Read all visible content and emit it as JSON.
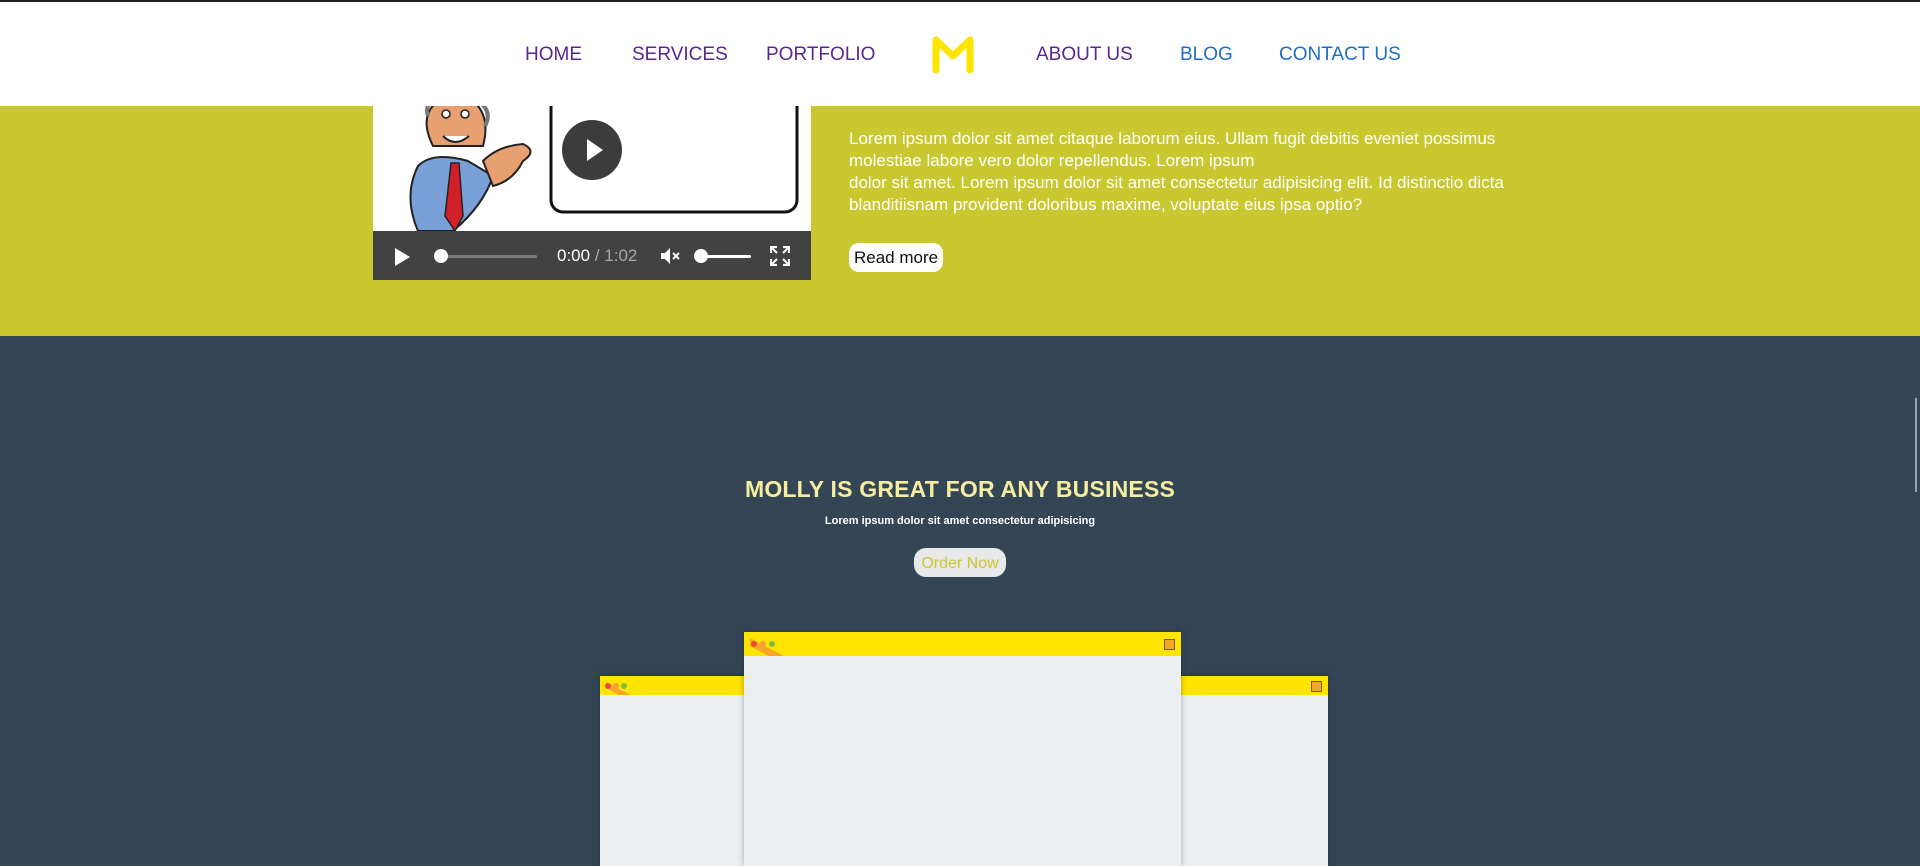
{
  "nav": {
    "left": [
      "HOME",
      "SERVICES",
      "PORTFOLIO"
    ],
    "right": [
      "ABOUT US",
      "BLOG",
      "CONTACT US"
    ],
    "logo_icon": "m-logo",
    "logo_color": "#ffe400",
    "link_color": "#5a2790",
    "visited_link_color": "#1f6ec5"
  },
  "hero": {
    "background": "#c9c830",
    "video": {
      "current_time": "0:00",
      "separator": "/",
      "duration": "1:02",
      "progress": 0,
      "volume": 0,
      "muted": true
    },
    "paragraph_lines": [
      "Lorem ipsum dolor sit amet citaque laborum eius. Ullam fugit debitis eveniet possimus",
      "molestiae labore vero dolor repellendus. Lorem ipsum",
      "dolor sit amet. Lorem ipsum dolor sit amet consectetur adipisicing elit. Id distinctio dicta",
      "blanditiisnam provident doloribus maxime, voluptate eius ipsa optio?"
    ],
    "read_more_label": "Read more"
  },
  "business": {
    "background": "#344655",
    "title": "MOLLY IS GREAT FOR ANY BUSINESS",
    "subtitle": "Lorem ipsum dolor sit amet consectetur adipisicing",
    "order_label": "Order Now",
    "accent": "#ffe400"
  }
}
